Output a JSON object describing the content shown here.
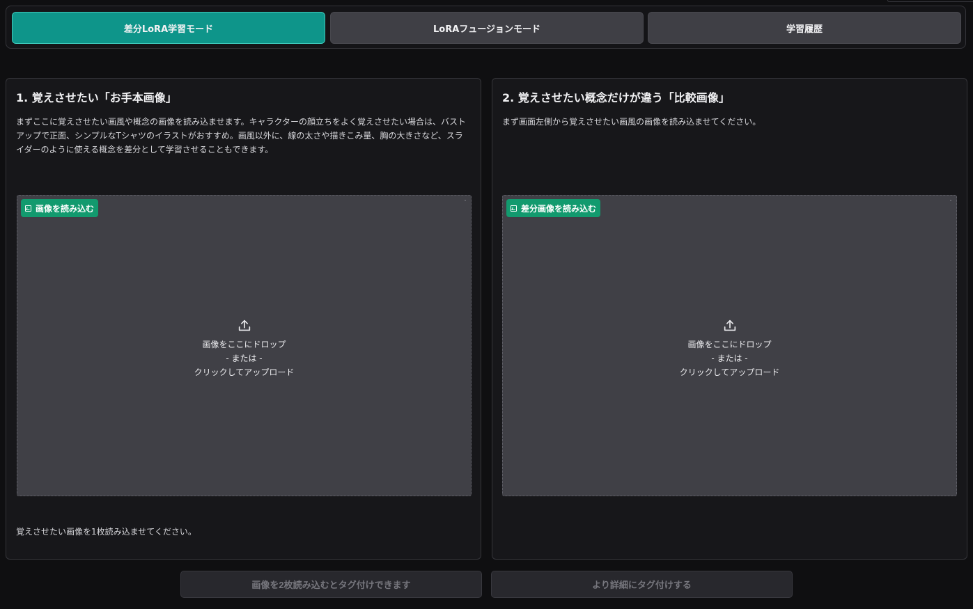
{
  "tabs": [
    {
      "label": "差分LoRA学習モード",
      "active": true
    },
    {
      "label": "LoRAフュージョンモード",
      "active": false
    },
    {
      "label": "学習履歴",
      "active": false
    }
  ],
  "left_panel": {
    "title": "1. 覚えさせたい「お手本画像」",
    "description": "まずここに覚えさせたい画風や概念の画像を読み込ませます。キャラクターの顔立ちをよく覚えさせたい場合は、バストアップで正面、シンプルなTシャツのイラストがおすすめ。画風以外に、線の太さや描きこみ量、胸の大きさなど、スライダーのように使える概念を差分として学習させることもできます。",
    "upload_badge": "画像を読み込む",
    "drop_line1": "画像をここにドロップ",
    "drop_line2": "- または -",
    "drop_line3": "クリックしてアップロード",
    "hint": "覚えさせたい画像を1枚読み込ませてください。"
  },
  "right_panel": {
    "title": "2. 覚えさせたい概念だけが違う「比較画像」",
    "description": "まず画面左側から覚えさせたい画風の画像を読み込ませてください。",
    "upload_badge": "差分画像を読み込む",
    "drop_line1": "画像をここにドロップ",
    "drop_line2": "- または -",
    "drop_line3": "クリックしてアップロード"
  },
  "buttons": {
    "tag_label": "画像を2枚読み込むとタグ付けできます",
    "detail_tag_label": "より詳細にタグ付けする"
  },
  "colors": {
    "accent": "#0e958a",
    "badge": "#129a6e",
    "background": "#0f0f11",
    "panel": "#17171a",
    "dropzone": "#404046"
  },
  "icons": {
    "upload": "upload-icon",
    "image": "image-icon"
  }
}
